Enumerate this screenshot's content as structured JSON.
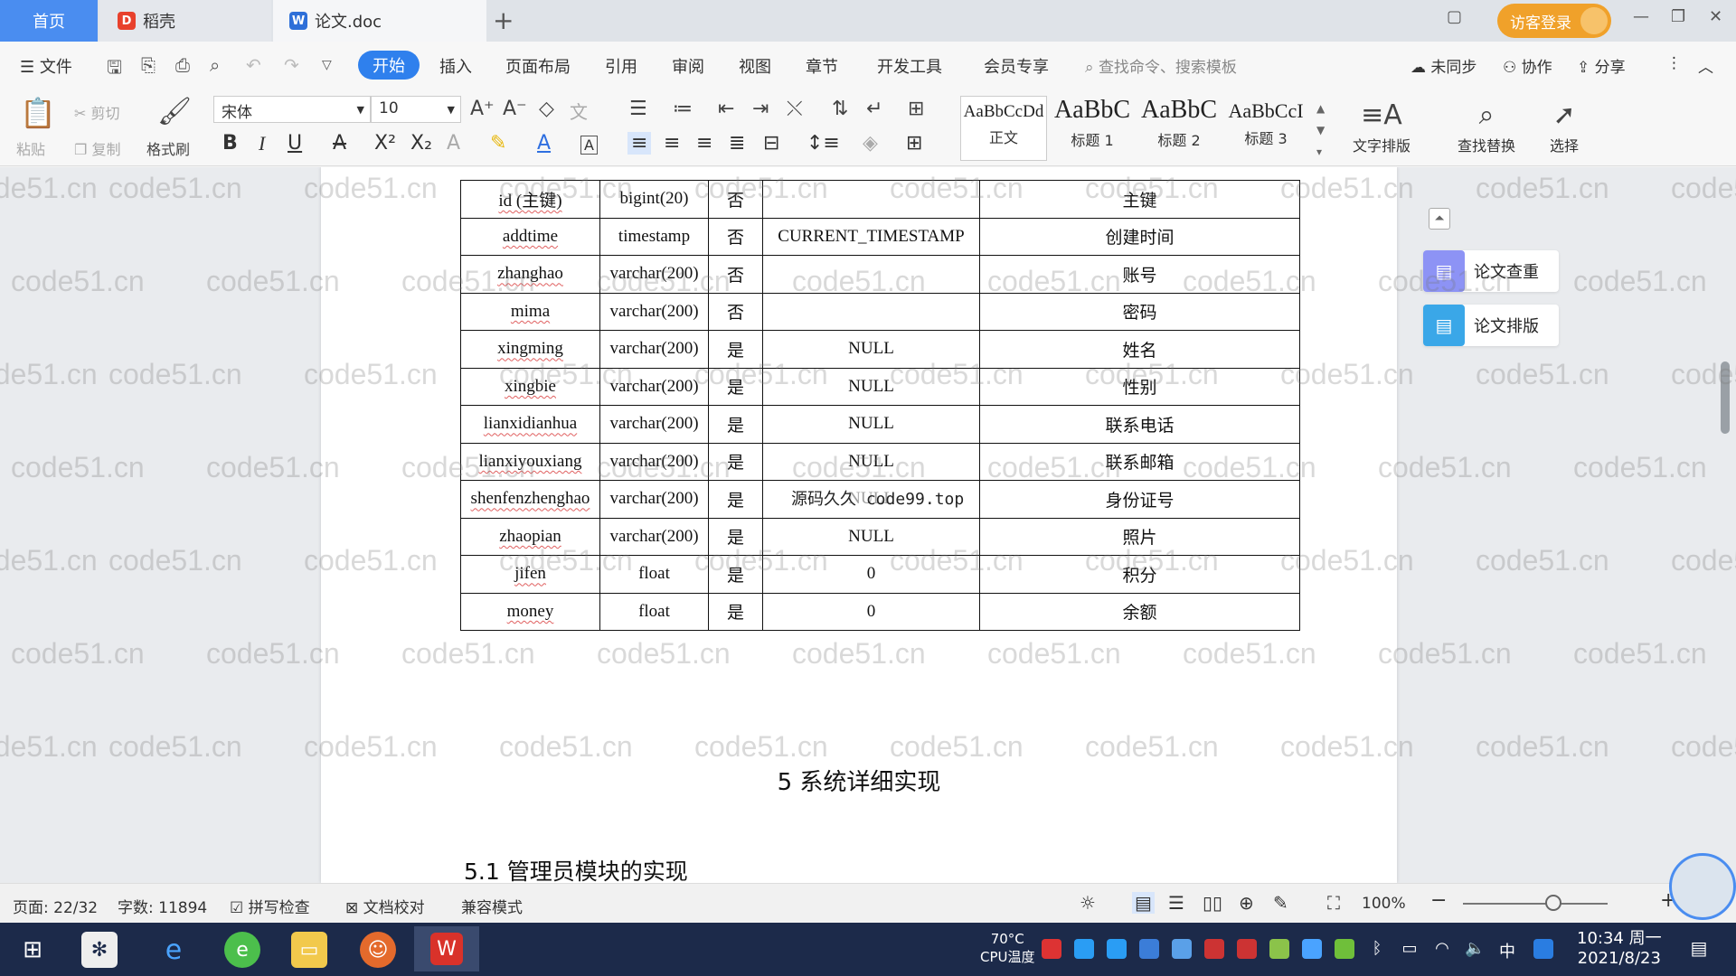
{
  "tabs": {
    "home": "首页",
    "daoke": "稻壳",
    "doc": "论文.doc",
    "add": "+"
  },
  "titlebar": {
    "login": "访客登录"
  },
  "menu": {
    "file": "文件",
    "items": [
      "开始",
      "插入",
      "页面布局",
      "引用",
      "审阅",
      "视图",
      "章节",
      "开发工具",
      "会员专享"
    ],
    "search_placeholder": "查找命令、搜索模板",
    "unsynced": "未同步",
    "collab": "协作",
    "share": "分享"
  },
  "ribbon": {
    "paste": "粘贴",
    "cut": "剪切",
    "copy": "复制",
    "format_painter": "格式刷",
    "font_name": "宋体",
    "font_size": "10",
    "styles": [
      {
        "sample": "AaBbCcDd",
        "label": "正文"
      },
      {
        "sample": "AaBbC",
        "label": "标题 1"
      },
      {
        "sample": "AaBbC",
        "label": "标题 2"
      },
      {
        "sample": "AaBbCcI",
        "label": "标题 3"
      }
    ],
    "text_layout": "文字排版",
    "find_replace": "查找替换",
    "select": "选择"
  },
  "table": {
    "rows": [
      [
        "id (主键)",
        "bigint(20)",
        "否",
        "",
        "主键"
      ],
      [
        "addtime",
        "timestamp",
        "否",
        "CURRENT_TIMESTAMP",
        "创建时间"
      ],
      [
        "zhanghao",
        "varchar(200)",
        "否",
        "",
        "账号"
      ],
      [
        "mima",
        "varchar(200)",
        "否",
        "",
        "密码"
      ],
      [
        "xingming",
        "varchar(200)",
        "是",
        "NULL",
        "姓名"
      ],
      [
        "xingbie",
        "varchar(200)",
        "是",
        "NULL",
        "性别"
      ],
      [
        "lianxidianhua",
        "varchar(200)",
        "是",
        "NULL",
        "联系电话"
      ],
      [
        "lianxiyouxiang",
        "varchar(200)",
        "是",
        "NULL",
        "联系邮箱"
      ],
      [
        "shenfenzhenghao",
        "varchar(200)",
        "是",
        "NULL",
        "身份证号"
      ],
      [
        "zhaopian",
        "varchar(200)",
        "是",
        "NULL",
        "照片"
      ],
      [
        "jifen",
        "float",
        "是",
        "0",
        "积分"
      ],
      [
        "money",
        "float",
        "是",
        "0",
        "余额"
      ]
    ]
  },
  "overlay_watermark": "源码久久 code99.top",
  "chapter_heading": "5 系统详细实现",
  "section_heading": "5.1 管理员模块的实现",
  "side_panel": {
    "check": "论文查重",
    "format": "论文排版"
  },
  "watermark_text": "code51.cn",
  "status": {
    "page": "页面: 22/32",
    "words": "字数: 11894",
    "spell": "拼写检查",
    "proof": "文档校对",
    "compat": "兼容模式",
    "zoom": "100%"
  },
  "taskbar": {
    "cpu_temp": "70°C",
    "cpu_label": "CPU温度",
    "time": "10:34 周一",
    "date": "2021/8/23",
    "ime": "中"
  }
}
